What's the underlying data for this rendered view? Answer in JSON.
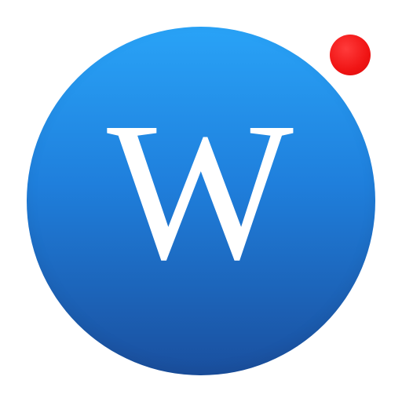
{
  "app_icon": {
    "letter": "W",
    "gradient_top": "#29a3f7",
    "gradient_bottom": "#1a4f9e",
    "letter_color": "#ffffff"
  },
  "notification_dot": {
    "color": "#f01414"
  }
}
